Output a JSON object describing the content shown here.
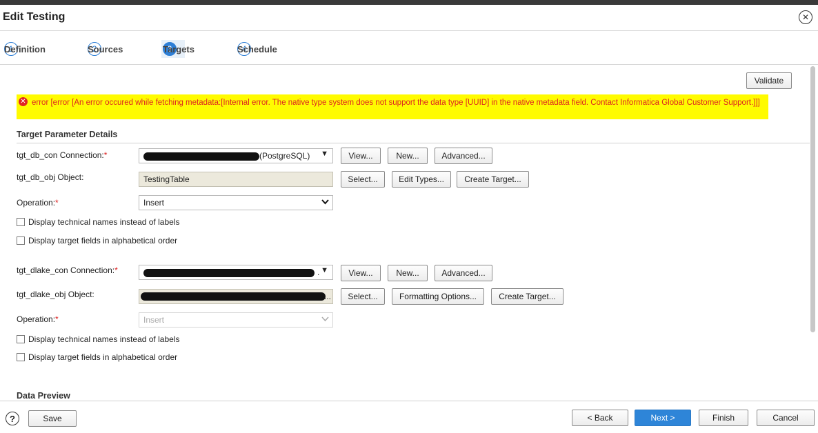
{
  "window": {
    "title": "Edit Testing"
  },
  "steps": [
    {
      "num": "1",
      "label": "Definition"
    },
    {
      "num": "2",
      "label": "Sources"
    },
    {
      "num": "3",
      "label": "Targets"
    },
    {
      "num": "4",
      "label": "Schedule"
    }
  ],
  "active_step": "Targets",
  "validate_label": "Validate",
  "error": {
    "text": "error [error [An error occured while fetching metadata:[Internal error. The native type system does not support the data type [UUID] in the native metadata field. Contact Informatica Global Customer Support.]]]"
  },
  "target_params": {
    "title": "Target Parameter Details",
    "db_con": {
      "label": "tgt_db_con Connection:",
      "required": "*",
      "value_suffix": "(PostgreSQL)",
      "buttons": [
        "View...",
        "New...",
        "Advanced..."
      ]
    },
    "db_obj": {
      "label": "tgt_db_obj Object:",
      "value": "TestingTable",
      "buttons": [
        "Select...",
        "Edit Types...",
        "Create Target..."
      ]
    },
    "op1": {
      "label": "Operation:",
      "required": "*",
      "value": "Insert"
    },
    "check1a": "Display technical names instead of labels",
    "check1b": "Display target fields in alphabetical order",
    "dlake_con": {
      "label": "tgt_dlake_con Connection:",
      "required": "*",
      "buttons": [
        "View...",
        "New...",
        "Advanced..."
      ]
    },
    "dlake_obj": {
      "label": "tgt_dlake_obj Object:",
      "value_suffix": "...",
      "buttons": [
        "Select...",
        "Formatting Options...",
        "Create Target..."
      ]
    },
    "op2": {
      "label": "Operation:",
      "required": "*",
      "value": "Insert"
    },
    "check2a": "Display technical names instead of labels",
    "check2b": "Display target fields in alphabetical order"
  },
  "data_preview": {
    "title": "Data Preview"
  },
  "footer": {
    "help": "?",
    "save": "Save",
    "back": "< Back",
    "next": "Next >",
    "finish": "Finish",
    "cancel": "Cancel"
  },
  "colors": {
    "accent": "#2e85d8",
    "error": "#dd2222",
    "highlight": "#fffb00"
  },
  "icons": {
    "close": "close-circle-icon",
    "error": "error-circle-icon",
    "help": "help-circle-icon",
    "chevron": "chevron-down-icon"
  }
}
